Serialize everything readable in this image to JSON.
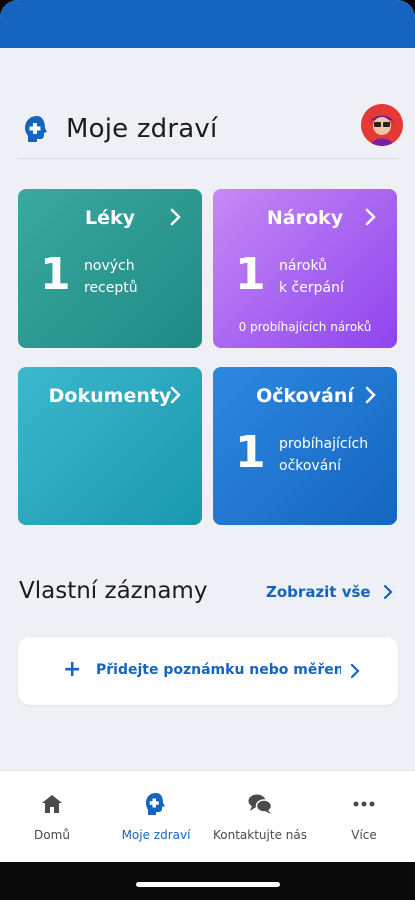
{
  "header": {
    "title": "Moje zdraví"
  },
  "tiles": {
    "leky": {
      "title": "Léky",
      "count": "1",
      "label_line1": "nových",
      "label_line2": "receptů"
    },
    "naroky": {
      "title": "Nároky",
      "count": "1",
      "label_line1": "nároků",
      "label_line2": "k čerpání",
      "note": "0 probíhajících nároků"
    },
    "dokumenty": {
      "title": "Dokumenty"
    },
    "ockovani": {
      "title": "Očkování",
      "count": "1",
      "label_line1": "probíhajících",
      "label_line2": "očkování"
    }
  },
  "records": {
    "title": "Vlastní záznamy",
    "show_all": "Zobrazit vše",
    "add_plus": "+",
    "add_note": "Přidejte poznámku nebo měření"
  },
  "nav": {
    "home": "Domů",
    "my_health": "Moje zdraví",
    "contact": "Kontaktujte nás",
    "more": "Více"
  },
  "colors": {
    "brand_blue": "#1565c0",
    "tile_leky": "#2a9890",
    "tile_naroky": "#a866f2",
    "tile_dokumenty": "#2aa8be",
    "tile_ockovani": "#1f76d0"
  }
}
